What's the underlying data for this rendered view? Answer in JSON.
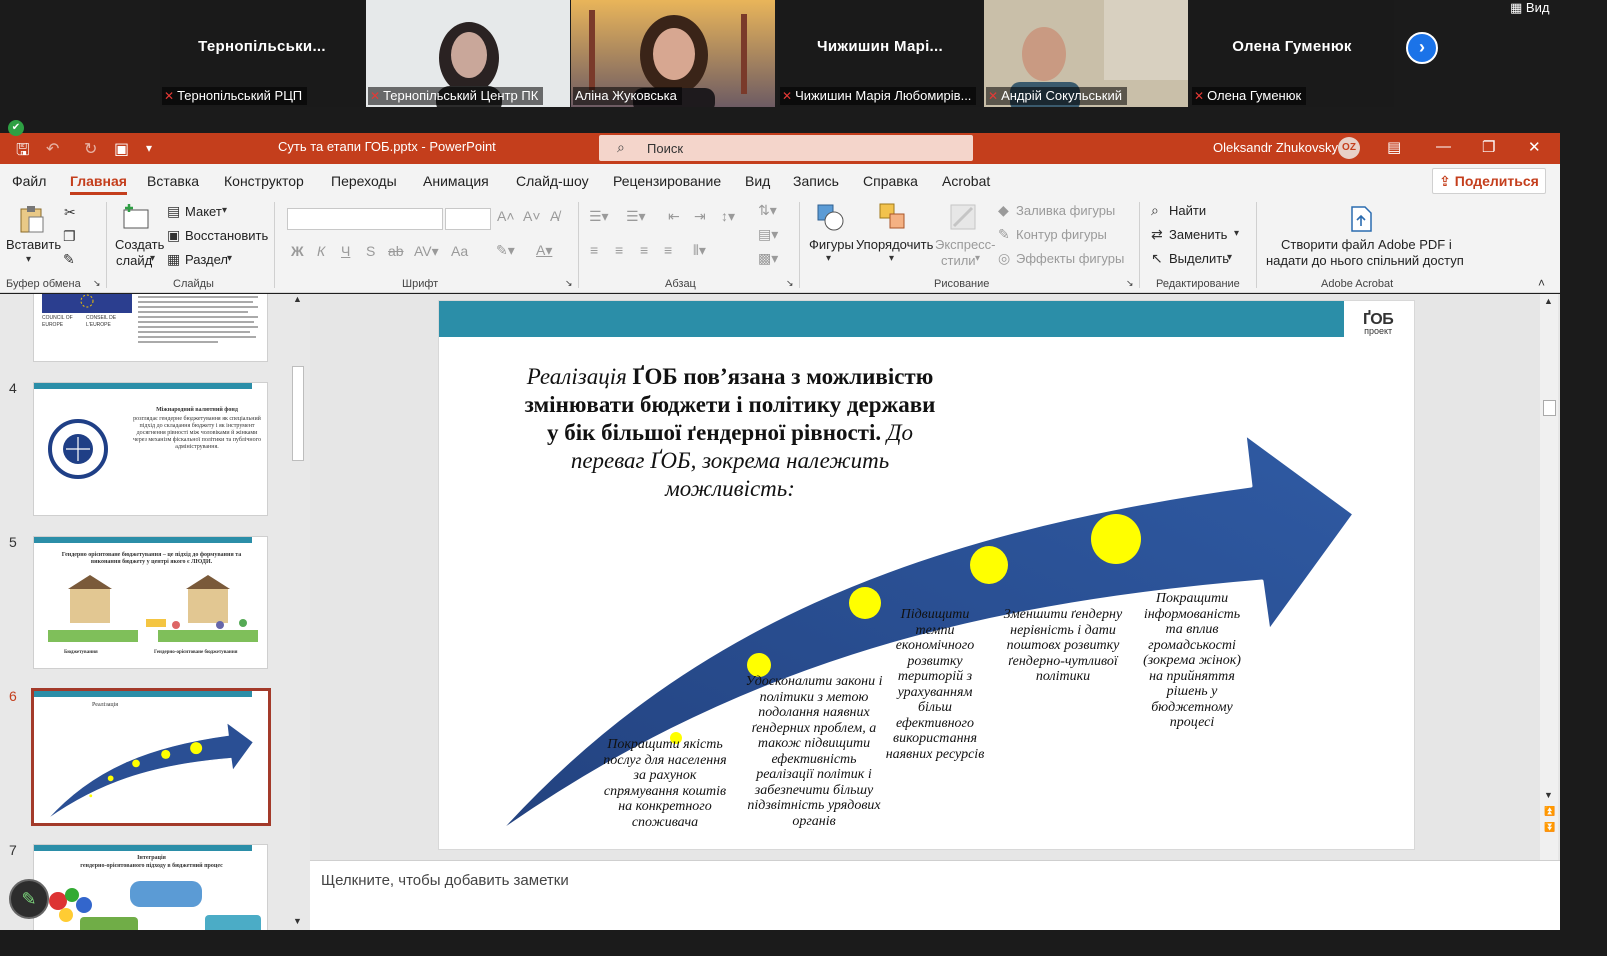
{
  "zoom": {
    "view_label": "Вид",
    "tiles": [
      {
        "name": "Тернопільськи...",
        "label": "Тернопільський РЦП"
      },
      {
        "label": "Тернопільський Центр ПК"
      },
      {
        "label": "Аліна Жуковська"
      },
      {
        "name": "Чижишин Марі...",
        "label": "Чижишин Марія Любомирів..."
      },
      {
        "label": "Андрій Сокульський"
      },
      {
        "name": "Олена Гуменюк",
        "label": "Олена Гуменюк"
      }
    ],
    "next_icon": "chevron-right-icon"
  },
  "titlebar": {
    "document": "Суть та етапи ГОБ.pptx  -  PowerPoint",
    "search_placeholder": "Поиск",
    "user_name": "Oleksandr Zhukovsky",
    "user_initials": "OZ",
    "accent": "#c43e1c"
  },
  "tabs": [
    "Файл",
    "Главная",
    "Вставка",
    "Конструктор",
    "Переходы",
    "Анимация",
    "Слайд-шоу",
    "Рецензирование",
    "Вид",
    "Запись",
    "Справка",
    "Acrobat"
  ],
  "share_label": "Поделиться",
  "ribbon": {
    "clipboard": {
      "paste": "Вставить",
      "group": "Буфер обмена"
    },
    "slides": {
      "new_slide_1": "Создать",
      "new_slide_2": "слайд",
      "layout": "Макет",
      "reset": "Восстановить",
      "section": "Раздел",
      "group": "Слайды"
    },
    "font": {
      "group": "Шрифт",
      "bold": "Ж",
      "italic": "К",
      "underline": "Ч",
      "strike": "S",
      "strike2": "ab",
      "case": "Aa"
    },
    "paragraph": {
      "group": "Абзац"
    },
    "drawing": {
      "shapes": "Фигуры",
      "arrange": "Упорядочить",
      "express_1": "Экспресс-",
      "express_2": "стили",
      "fill": "Заливка фигуры",
      "outline": "Контур фигуры",
      "effects": "Эффекты фигуры",
      "group": "Рисование"
    },
    "editing": {
      "find": "Найти",
      "replace": "Заменить",
      "select": "Выделить",
      "group": "Редактирование"
    },
    "acrobat": {
      "line1": "Створити файл Adobe PDF і",
      "line2": "надати до нього спільний доступ",
      "group": "Adobe Acrobat"
    }
  },
  "thumbnails": {
    "numbers": [
      "4",
      "5",
      "6",
      "7"
    ],
    "slide3_logo_1": "COUNCIL OF EUROPE",
    "slide3_logo_2": "CONSEIL DE L'EUROPE",
    "slide4_title": "Міжнародний валютний фонд",
    "slide4_text": "розглядає гендерне бюджетування як спеціальний підхід до складання бюджету і як інструмент досягнення рівності між чоловіками й жінками через механізм фіскальної політики та публічного адміністрування.",
    "slide5_title": "Гендерно орієнтоване бюджетування – це підхід до формування та виконання бюджету у центрі якого є ЛЮДИ.",
    "slide5_cap1": "Бюджетування",
    "slide5_cap2": "Гендерно-орієнтоване бюджетування",
    "slide7_title_1": "Інтеграція",
    "slide7_title_2": "гендерно-орієнтованого підходу в бюджетний процес"
  },
  "slide": {
    "logo_line1": "ҐОБ",
    "logo_line2": "проект",
    "title_it1": "Реалізація",
    "title_b1": " ҐОБ пов’язана з можливістю змінювати бюджети і політику держави у бік більшої ґендерної рівності.",
    "title_it2": " До переваг ҐОБ, зокрема  належить можливість:",
    "arrow_color": "#2a4f94",
    "dot_color": "#ffff00",
    "items": [
      "Покращити якість послуг для населення за рахунок спрямування коштів на конкретного споживача",
      "Удосконалити закони і політики з метою подолання наявних ґендерних проблем, а також підвищити ефективність реалізації політик і забезпечити більшу підзвітність урядових органів",
      "Підвищити темпи економічного розвитку територій з урахуванням більш ефективного використання наявних ресурсів",
      "Зменшити ґендерну нерівність і дати поштовх розвитку ґендерно-чутливої політики",
      "Покращити інформованість та вплив громадськості (зокрема жінок) на прийняття рішень у бюджетному процесі"
    ]
  },
  "notes_placeholder": "Щелкните, чтобы добавить заметки"
}
